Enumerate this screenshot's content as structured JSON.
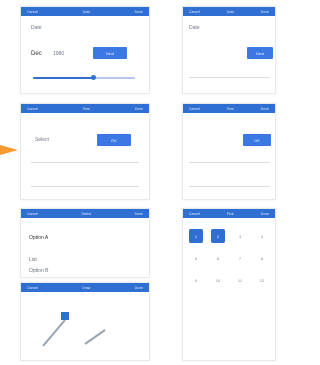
{
  "panels": {
    "left_1": {
      "header": [
        "Cancel",
        "Date",
        "Done"
      ],
      "label": "Date",
      "value_main": "Dec",
      "value_sub": "1980",
      "button": "Next"
    },
    "left_2": {
      "header": [
        "Cancel",
        "Time",
        "Done"
      ],
      "label": "Select",
      "button": "OK"
    },
    "left_3": {
      "header": [
        "Cancel",
        "Select",
        "Done"
      ],
      "label_main": "Option A",
      "label_section": "List",
      "label_sub": "Option B"
    },
    "left_4": {
      "header": [
        "Cancel",
        "Draw",
        "Done"
      ]
    },
    "right_1": {
      "header": [
        "Cancel",
        "Date",
        "Done"
      ],
      "label": "Date",
      "button": "Next"
    },
    "right_2": {
      "header": [
        "Cancel",
        "Time",
        "Done"
      ],
      "button": "OK"
    },
    "right_3": {
      "header": [
        "Cancel",
        "Pick",
        "Done"
      ],
      "numbers": [
        "1",
        "2",
        "3",
        "4",
        "5",
        "6",
        "7",
        "8",
        "9",
        "10",
        "11",
        "12"
      ],
      "selected": [
        0,
        1
      ]
    }
  },
  "colors": {
    "accent": "#2f6fd2",
    "arrow": "#f59b2e"
  }
}
